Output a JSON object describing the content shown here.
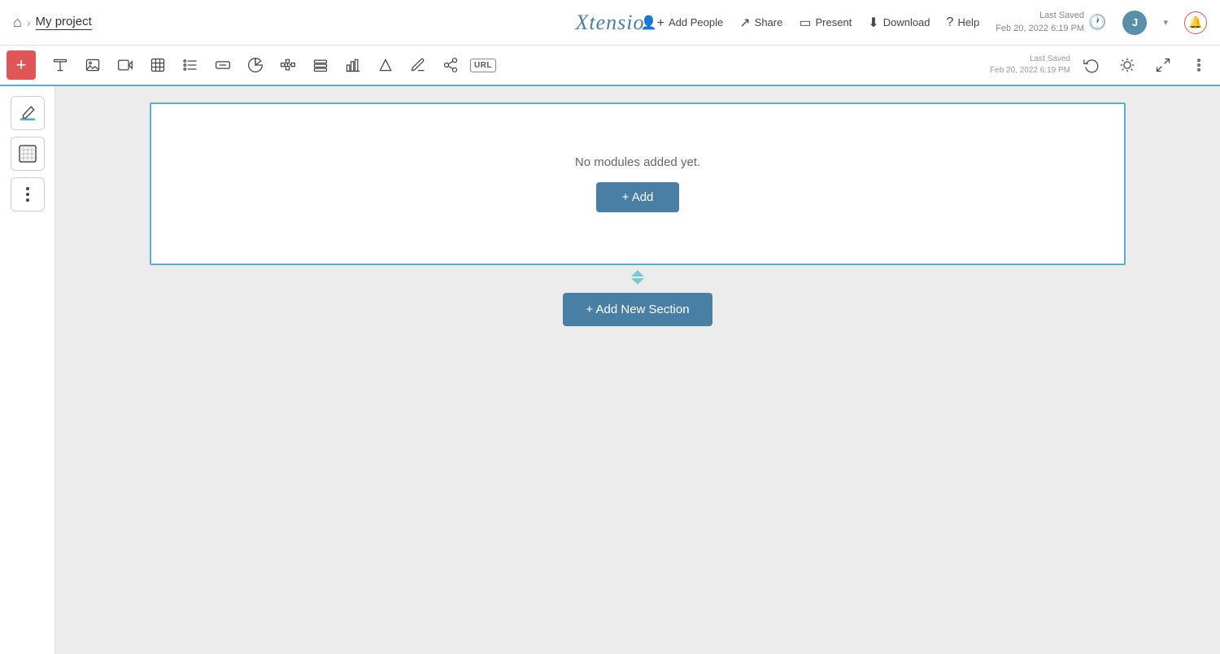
{
  "topnav": {
    "home_icon": "⌂",
    "chevron": "›",
    "project_title": "My project",
    "logo": "Xtensio",
    "add_people_label": "Add People",
    "share_label": "Share",
    "present_label": "Present",
    "download_label": "Download",
    "help_label": "Help",
    "last_saved_label": "Last Saved",
    "last_saved_date": "Feb 20, 2022 6:19 PM",
    "avatar_initial": "J"
  },
  "toolbar": {
    "add_label": "+",
    "tools": [
      {
        "name": "text-tool",
        "icon": "T"
      },
      {
        "name": "image-tool",
        "icon": "IMG"
      },
      {
        "name": "video-tool",
        "icon": "▶"
      },
      {
        "name": "table-tool",
        "icon": "TBL"
      },
      {
        "name": "list-tool",
        "icon": "LIST"
      },
      {
        "name": "button-tool",
        "icon": "BTN"
      },
      {
        "name": "pie-chart-tool",
        "icon": "PIE"
      },
      {
        "name": "diagram-tool",
        "icon": "DIAG"
      },
      {
        "name": "stack-tool",
        "icon": "STACK"
      },
      {
        "name": "bar-chart-tool",
        "icon": "BAR"
      },
      {
        "name": "shape-tool",
        "icon": "SHAPE"
      },
      {
        "name": "whiteboard-tool",
        "icon": "WB"
      },
      {
        "name": "share-tool",
        "icon": "SHARE"
      },
      {
        "name": "url-tool",
        "icon": "URL"
      }
    ],
    "right_tools": [
      {
        "name": "history-tool",
        "icon": "⏰"
      },
      {
        "name": "paint-tool",
        "icon": "🎨"
      },
      {
        "name": "expand-tool",
        "icon": "⛶"
      },
      {
        "name": "more-tool",
        "icon": "⋮"
      }
    ]
  },
  "sidebar": {
    "tools": [
      {
        "name": "fill-tool",
        "icon": "◈"
      },
      {
        "name": "pattern-tool",
        "icon": "▦"
      },
      {
        "name": "more-options-tool",
        "icon": "⋮"
      }
    ]
  },
  "canvas": {
    "no_modules_text": "No modules added yet.",
    "add_button_label": "+ Add",
    "add_section_label": "+ Add New Section"
  }
}
